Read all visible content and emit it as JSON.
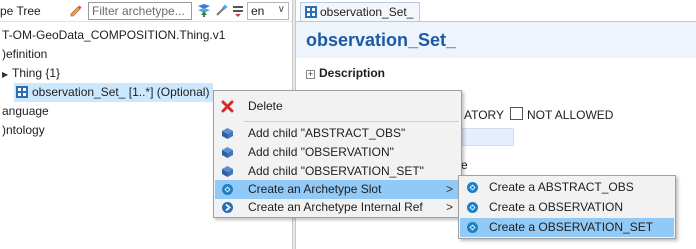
{
  "left_pane": {
    "title": "pe Tree",
    "filter_placeholder": "Filter archetype...",
    "language": "en",
    "tree": [
      {
        "label": "T-OM-GeoData_COMPOSITION.Thing.v1"
      },
      {
        "label": ")efinition"
      },
      {
        "label": "Thing {1}"
      },
      {
        "label": "observation_Set_ [1..*] (Optional)"
      },
      {
        "label": "anguage"
      },
      {
        "label": ")ntology"
      }
    ]
  },
  "editor": {
    "tab_label": "observation_Set_",
    "heading": "observation_Set_",
    "description_label": "Description",
    "occurrence_text": "ATORY",
    "not_allowed_label": "NOT ALLOWED",
    "partial_text": "e"
  },
  "context_menu": {
    "items": [
      {
        "label": "Delete",
        "icon": "delete-icon"
      },
      {
        "label": "Add child \"ABSTRACT_OBS\"",
        "icon": "add-child-icon"
      },
      {
        "label": "Add child \"OBSERVATION\"",
        "icon": "add-child-icon"
      },
      {
        "label": "Add child \"OBSERVATION_SET\"",
        "icon": "add-child-icon"
      },
      {
        "label": "Create an Archetype Slot",
        "icon": "archetype-slot-icon",
        "has_submenu": true,
        "highlighted": true
      },
      {
        "label": "Create an Archetype Internal Ref",
        "icon": "internal-ref-icon",
        "has_submenu": true
      }
    ],
    "submenu_arrow": ">"
  },
  "sub_menu": {
    "items": [
      {
        "label": "Create a ABSTRACT_OBS",
        "icon": "archetype-slot-icon"
      },
      {
        "label": "Create a OBSERVATION",
        "icon": "archetype-slot-icon"
      },
      {
        "label": "Create a OBSERVATION_SET",
        "icon": "archetype-slot-icon",
        "highlighted": true
      }
    ]
  },
  "colors": {
    "selection": "#cce8ff",
    "menu_highlight": "#91c9f7",
    "heading": "#1b5aa5"
  }
}
